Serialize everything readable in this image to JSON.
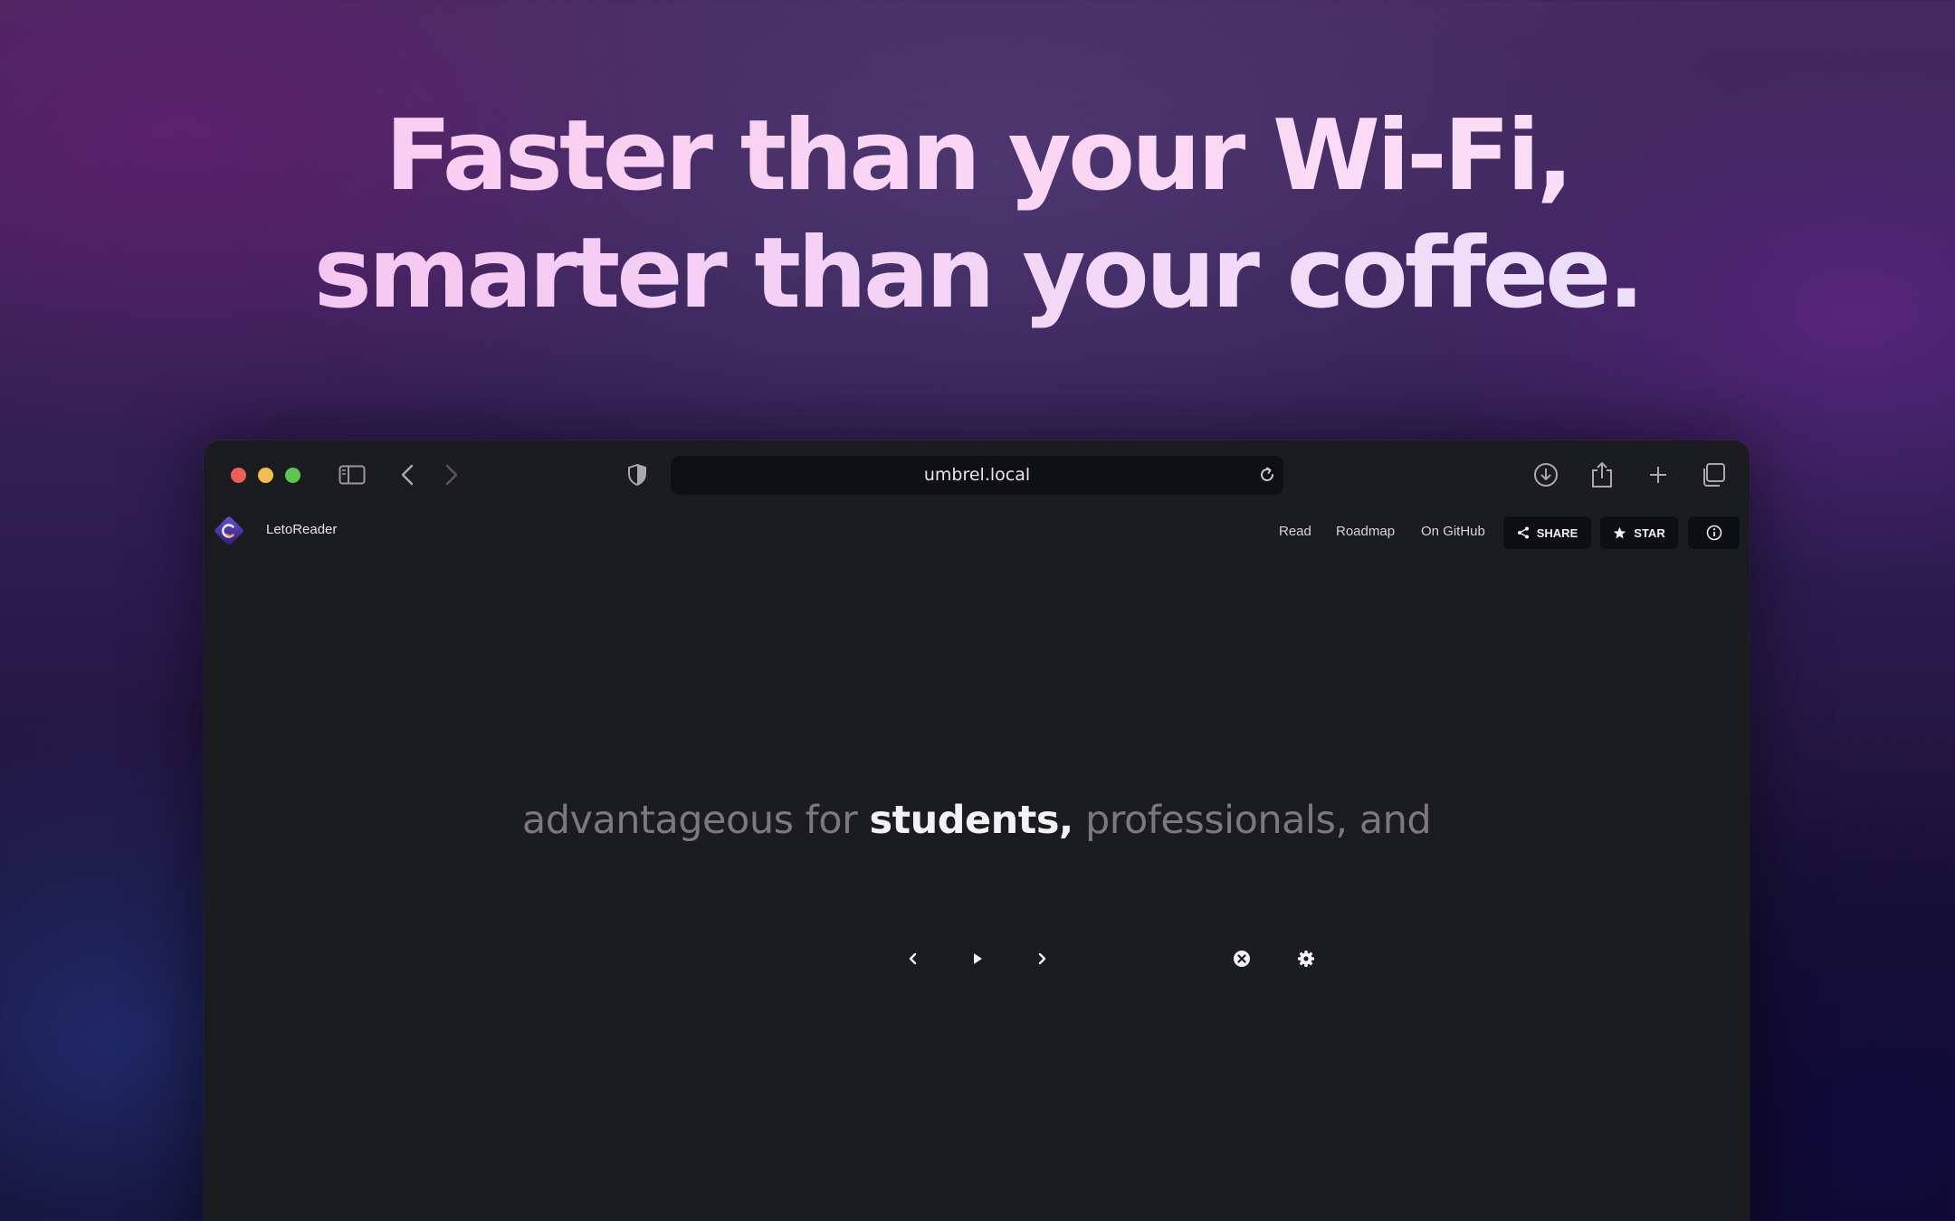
{
  "hero": {
    "line1": "Faster than your Wi-Fi,",
    "line2": "smarter than your coffee."
  },
  "browser": {
    "url": "umbrel.local",
    "icons": [
      "sidebar-icon",
      "back-icon",
      "forward-icon",
      "shield-icon",
      "reload-icon",
      "download-icon",
      "share-icon",
      "new-tab-icon",
      "tabs-icon"
    ]
  },
  "app": {
    "name": "LetoReader",
    "nav": {
      "read": "Read",
      "roadmap": "Roadmap",
      "github": "On GitHub"
    },
    "share_label": "SHARE",
    "star_label": "STAR"
  },
  "reader": {
    "before": "advantageous for",
    "current": "students,",
    "after": "professionals, and"
  },
  "colors": {
    "accent": "#f6c0ee",
    "window_bg": "#1b1c1f",
    "traffic_red": "#ec5f57",
    "traffic_yellow": "#f3bd4f",
    "traffic_green": "#5ec54f"
  }
}
